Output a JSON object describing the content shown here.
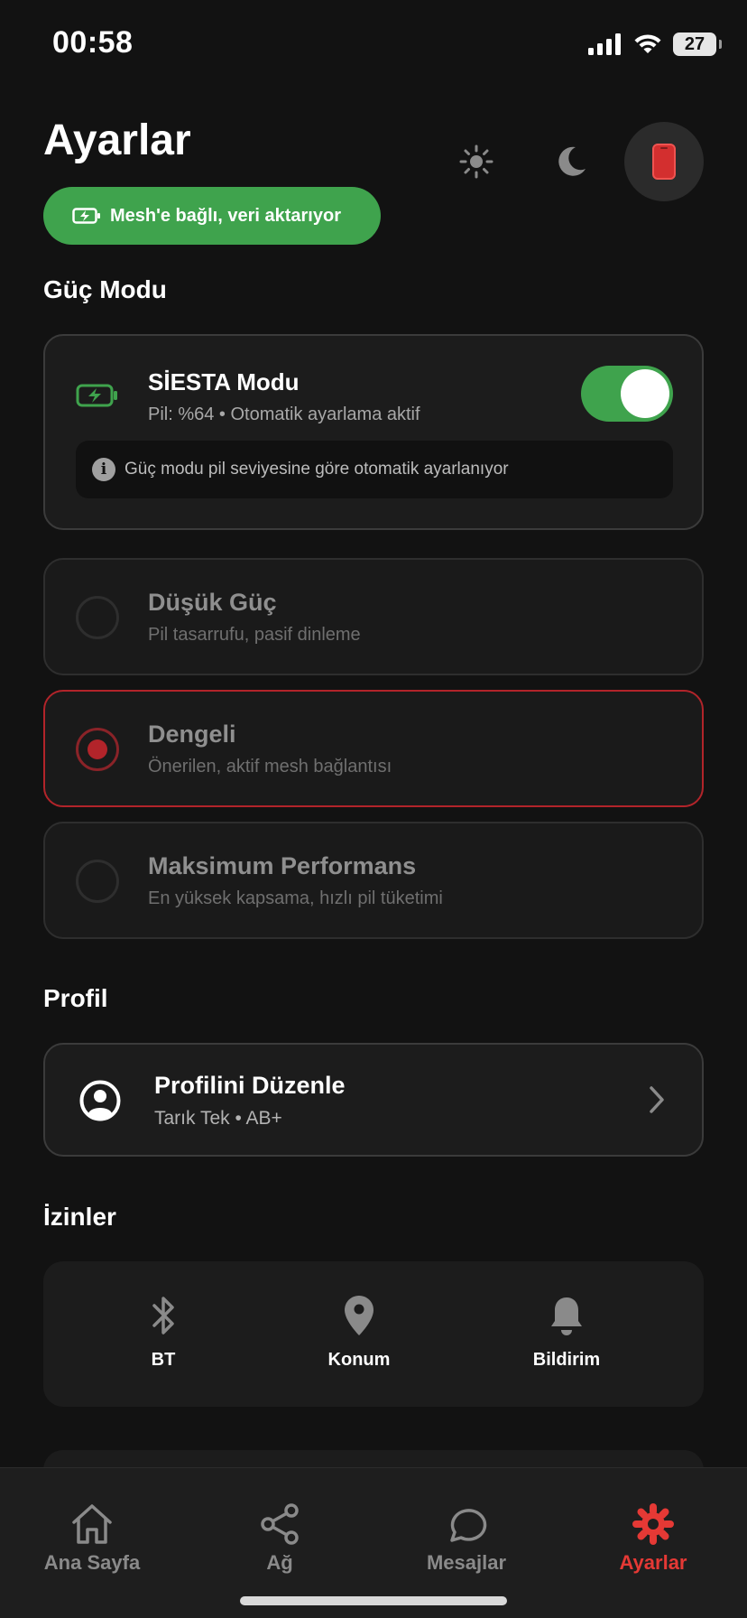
{
  "status_bar": {
    "time": "00:58",
    "battery": "27"
  },
  "header": {
    "title": "Ayarlar",
    "mesh_status": "Mesh'e bağlı, veri aktarıyor"
  },
  "power": {
    "section_title": "Güç Modu",
    "siesta": {
      "title": "SİESTA Modu",
      "subtitle": "Pil: %64 • Otomatik ayarlama aktif",
      "enabled": true,
      "info": "Güç modu pil seviyesine göre otomatik ayarlanıyor"
    },
    "modes": [
      {
        "title": "Düşük Güç",
        "desc": "Pil tasarrufu, pasif dinleme",
        "selected": false
      },
      {
        "title": "Dengeli",
        "desc": "Önerilen, aktif mesh bağlantısı",
        "selected": true
      },
      {
        "title": "Maksimum Performans",
        "desc": "En yüksek kapsama, hızlı pil tüketimi",
        "selected": false
      }
    ]
  },
  "profile": {
    "section_title": "Profil",
    "name": "Profilini Düzenle",
    "subtitle": "Tarık Tek • AB+"
  },
  "permissions": {
    "section_title": "İzinler",
    "items": [
      {
        "label": "BT",
        "icon": "bluetooth-icon"
      },
      {
        "label": "Konum",
        "icon": "location-pin-icon"
      },
      {
        "label": "Bildirim",
        "icon": "bell-icon"
      }
    ]
  },
  "tabbar": {
    "tabs": [
      {
        "label": "Ana Sayfa",
        "icon": "home-icon",
        "active": false
      },
      {
        "label": "Ağ",
        "icon": "share-network-icon",
        "active": false
      },
      {
        "label": "Mesajlar",
        "icon": "chat-bubble-icon",
        "active": false
      },
      {
        "label": "Ayarlar",
        "icon": "gear-icon",
        "active": true
      }
    ]
  },
  "colors": {
    "background": "#121212",
    "card": "#1c1c1c",
    "accent_green": "#3fa34d",
    "accent_red": "#e53935",
    "selected_border": "#b2242a"
  }
}
